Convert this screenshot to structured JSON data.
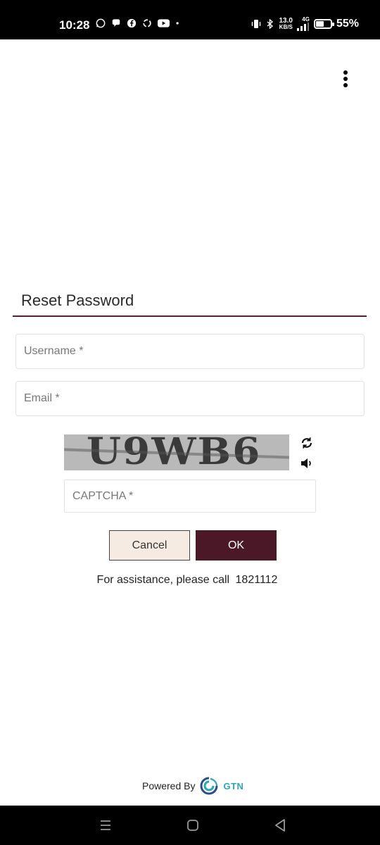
{
  "status_bar": {
    "time": "10:28",
    "network_speed_value": "13.0",
    "network_speed_unit": "KB/S",
    "network_type": "4G",
    "battery_percent": "55%",
    "battery_level": 0.55,
    "left_icons": [
      "whatsapp-icon",
      "chat-bubble-icon",
      "facebook-icon",
      "sync-icon",
      "youtube-icon",
      "dot-icon"
    ],
    "right_icons": [
      "vibrate-icon",
      "bluetooth-icon",
      "signal-icon",
      "battery-icon"
    ]
  },
  "header": {
    "overflow_icon": "more-vertical-icon"
  },
  "form": {
    "title": "Reset Password",
    "accent_color": "#4a1826",
    "username_placeholder": "Username *",
    "email_placeholder": "Email *",
    "captcha_text": "U9WB6",
    "captcha_placeholder": "CAPTCHA *",
    "refresh_icon": "refresh-icon",
    "audio_icon": "speaker-icon",
    "cancel_label": "Cancel",
    "ok_label": "OK",
    "assist_text": "For assistance, please call",
    "assist_phone": "1821112"
  },
  "footer": {
    "powered_by": "Powered By",
    "brand": "GTN",
    "brand_color": "#2aa7b8"
  },
  "nav_bar": {
    "icons": [
      "recents-menu-icon",
      "home-icon",
      "back-icon"
    ]
  }
}
